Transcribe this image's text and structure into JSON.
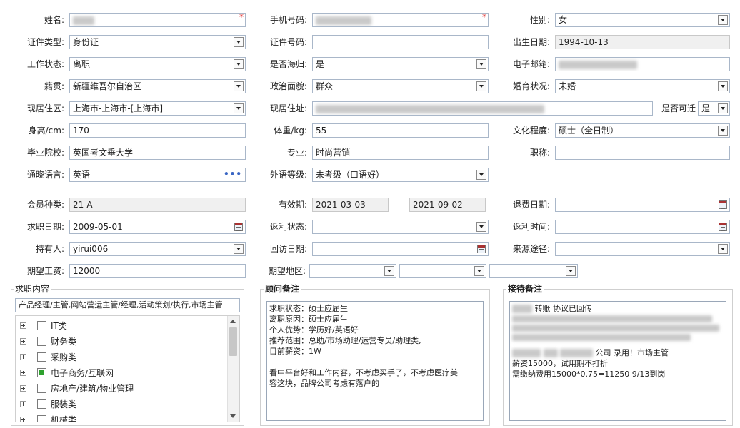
{
  "row1": {
    "name_label": "姓名:",
    "phone_label": "手机号码:",
    "gender_label": "性别:",
    "gender_value": "女",
    "required_mark": "*"
  },
  "row2": {
    "idtype_label": "证件类型:",
    "idtype_value": "身份证",
    "idno_label": "证件号码:",
    "birth_label": "出生日期:",
    "birth_value": "1994-10-13"
  },
  "row3": {
    "work_label": "工作状态:",
    "work_value": "离职",
    "overseas_label": "是否海归:",
    "overseas_value": "是",
    "email_label": "电子邮箱:"
  },
  "row4": {
    "native_label": "籍贯:",
    "native_value": "新疆维吾尔自治区",
    "political_label": "政治面貌:",
    "political_value": "群众",
    "marital_label": "婚育状况:",
    "marital_value": "未婚"
  },
  "row5": {
    "region_label": "现居住区:",
    "region_value": "上海市-上海市-[上海市]",
    "address_label": "现居住址:",
    "relocate_label": "是否可迁",
    "relocate_value": "是"
  },
  "row6": {
    "height_label": "身高/cm:",
    "height_value": "170",
    "weight_label": "体重/kg:",
    "weight_value": "55",
    "edu_label": "文化程度:",
    "edu_value": "硕士（全日制）"
  },
  "row7": {
    "school_label": "毕业院校:",
    "school_value": "英国考文垂大学",
    "major_label": "专业:",
    "major_value": "时尚营销",
    "title_label": "职称:"
  },
  "row8": {
    "lang_label": "通晓语言:",
    "lang_value": "英语",
    "lang_more": "•••",
    "flevel_label": "外语等级:",
    "flevel_value": "未考级（口语好）"
  },
  "member": {
    "type_label": "会员种类:",
    "type_value": "21-A",
    "valid_label": "有效期:",
    "valid_from": "2021-03-03",
    "valid_sep": "----",
    "valid_to": "2021-09-02",
    "refund_label": "退费日期:",
    "job_date_label": "求职日期:",
    "job_date_value": "2009-05-01",
    "rebate_status_label": "返利状态:",
    "rebate_time_label": "返利时间:",
    "holder_label": "持有人:",
    "holder_value": "yirui006",
    "visit_label": "回访日期:",
    "source_label": "来源途径:",
    "salary_label": "期望工资:",
    "salary_value": "12000",
    "area_label": "期望地区:"
  },
  "job_box": {
    "title": "求职内容",
    "summary": "产品经理/主管,网站营运主管/经理,活动策划/执行,市场主管",
    "tree": [
      {
        "label": "IT类",
        "checked": false
      },
      {
        "label": "财务类",
        "checked": false
      },
      {
        "label": "采购类",
        "checked": false
      },
      {
        "label": "电子商务/互联网",
        "checked": true
      },
      {
        "label": "房地产/建筑/物业管理",
        "checked": false
      },
      {
        "label": "服装类",
        "checked": false
      },
      {
        "label": "机械类",
        "checked": false
      }
    ]
  },
  "advisor_box": {
    "title": "顾问备注",
    "lines": [
      "求职状态：硕士应届生",
      "离职原因：硕士应届生",
      "个人优势：学历好/英语好",
      "推荐范围：总助/市场助理/运营专员/助理类,",
      "目前薪资：1W",
      "",
      "看中平台好和工作内容，不考虑买手了，不考虑医疗美",
      "容这块，品牌公司考虑有落户的"
    ]
  },
  "reception_box": {
    "title": "接待备注",
    "line1": "转账 协议已回传",
    "line2": "公司 录用！市场主管",
    "line3": "薪资15000，试用期不打折",
    "line4": "需缴纳费用15000*0.75=11250 9/13到岗"
  },
  "colors": {
    "border": "#a9b7c9",
    "readonly_bg": "#f0f0f0",
    "required": "#e03030",
    "checked": "#2ea12e",
    "dots": "#3a66c4"
  }
}
